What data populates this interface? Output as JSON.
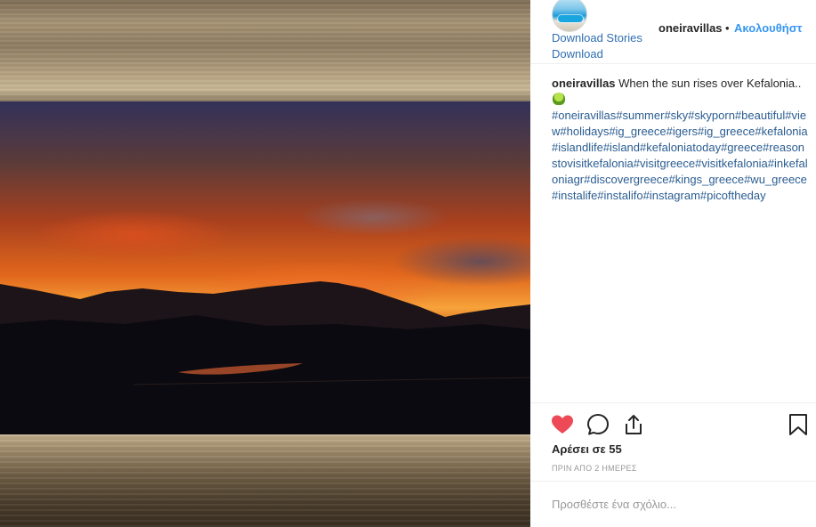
{
  "post": {
    "username": "oneiravillas",
    "dot": "•",
    "follow_label": "Ακολουθήστ",
    "download_stories": "Download Stories",
    "download": "Download"
  },
  "caption": {
    "username": "oneiravillas",
    "text": " When the sun rises over Kefalonia..",
    "emoji_icon": "green-alien-emoji-icon",
    "hashtags": "#oneiravillas#summer#sky#skyporn#beautiful#view#holidays#ig_greece#igers#ig_greece#kefalonia#islandlife#island#kefaloniatoday#greece#reasonstovisitkefalonia#visitgreece#visitkefalonia#inkefaloniagr#discovergreece#kings_greece#wu_greece#instalife#instalifo#instagram#picoftheday"
  },
  "actions": {
    "like_icon": "heart-icon",
    "comment_icon": "comment-bubble-icon",
    "share_icon": "share-icon",
    "save_icon": "bookmark-icon",
    "like_color": "#ed4956"
  },
  "likes_label": "Αρέσει σε 55",
  "timestamp": "ΠΡΙΝ ΑΠΟ 2 ΗΜΕΡΕΣ",
  "comment": {
    "placeholder": "Προσθέστε ένα σχόλιο..."
  }
}
